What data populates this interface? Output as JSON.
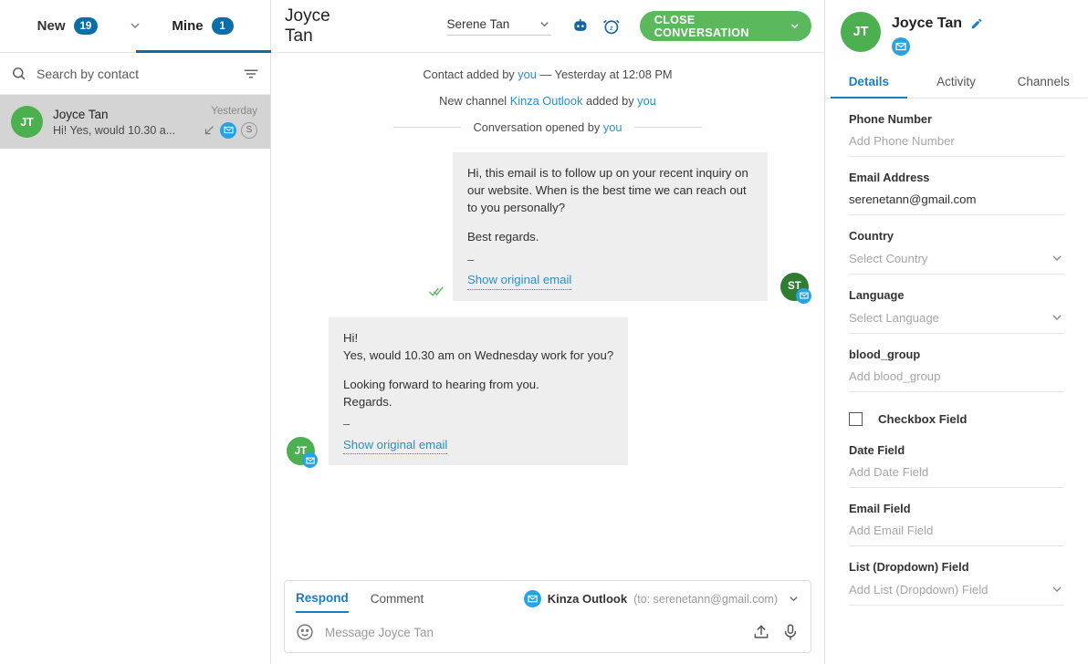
{
  "inbox": {
    "tabs": [
      {
        "label": "New",
        "count": "19",
        "active": false
      },
      {
        "label": "Mine",
        "count": "1",
        "active": true
      }
    ],
    "caret_icon": "chevron-down-icon",
    "search": {
      "placeholder": "Search by contact",
      "value": "",
      "icon": "search-icon",
      "filter_icon": "filter-icon"
    },
    "conversations": [
      {
        "initials": "JT",
        "name": "Joyce Tan",
        "preview": "Hi! Yes, would 10.30 a...",
        "time": "Yesterday",
        "direction_icon": "arrow-incoming-icon",
        "channel_icon": "email-icon",
        "status_badge": "S"
      }
    ]
  },
  "conversation": {
    "title": "Joyce Tan",
    "assignee": {
      "name": "Serene Tan",
      "caret_icon": "chevron-down-icon"
    },
    "bot_icon": "bot-icon",
    "snooze_icon": "alarm-snooze-icon",
    "close_button": {
      "label": "CLOSE CONVERSATION",
      "caret_icon": "chevron-down-icon",
      "color": "#5cb85c"
    },
    "system_events": [
      {
        "parts": [
          "Contact added by ",
          "you",
          " — Yesterday at 12:08 PM"
        ],
        "links": [
          1
        ]
      },
      {
        "parts": [
          "New channel ",
          "Kinza Outlook",
          " added by ",
          "you"
        ],
        "links": [
          1,
          3
        ]
      }
    ],
    "divider_event": {
      "prefix": "Conversation opened by ",
      "link": "you"
    },
    "messages": [
      {
        "direction": "outgoing",
        "initials": "ST",
        "avatar_color": "#2e7d32",
        "channel_icon": "email-icon",
        "read_receipt_icon": "double-check-icon",
        "body_paragraph": "Hi, this email is to follow up on your recent inquiry on our website. When is the best time we can reach out to you personally?",
        "signoff": "Best regards.",
        "dash": "–",
        "original_link": "Show original email"
      },
      {
        "direction": "incoming",
        "initials": "JT",
        "avatar_color": "#4caf50",
        "channel_icon": "email-icon",
        "line1": "Hi!",
        "line2": "Yes, would 10.30 am on Wednesday work for you?",
        "line3": "Looking forward to hearing from you.",
        "line4": "Regards.",
        "dash": "–",
        "original_link": "Show original email"
      }
    ],
    "composer": {
      "tabs": [
        {
          "label": "Respond",
          "active": true
        },
        {
          "label": "Comment",
          "active": false
        }
      ],
      "channel": {
        "name": "Kinza Outlook",
        "recipient": "(to: serenetann@gmail.com)",
        "icon": "email-icon",
        "caret_icon": "chevron-down-icon"
      },
      "emoji_icon": "emoji-icon",
      "input_placeholder": "Message Joyce Tan",
      "input_value": "",
      "attach_icon": "upload-icon",
      "mic_icon": "microphone-icon"
    }
  },
  "contact_panel": {
    "initials": "JT",
    "name": "Joyce Tan",
    "edit_icon": "pencil-icon",
    "channel_icon": "email-icon",
    "tabs": [
      {
        "label": "Details",
        "active": true
      },
      {
        "label": "Activity",
        "active": false
      },
      {
        "label": "Channels",
        "active": false
      }
    ],
    "fields": [
      {
        "type": "text",
        "label": "Phone Number",
        "value": "",
        "placeholder": "Add Phone Number"
      },
      {
        "type": "text",
        "label": "Email Address",
        "value": "serenetann@gmail.com",
        "placeholder": ""
      },
      {
        "type": "select",
        "label": "Country",
        "value": "",
        "placeholder": "Select Country"
      },
      {
        "type": "select",
        "label": "Language",
        "value": "",
        "placeholder": "Select Language"
      },
      {
        "type": "text",
        "label": "blood_group",
        "value": "",
        "placeholder": "Add blood_group"
      },
      {
        "type": "checkbox",
        "label": "Checkbox Field",
        "checked": false
      },
      {
        "type": "text",
        "label": "Date Field",
        "value": "",
        "placeholder": "Add Date Field"
      },
      {
        "type": "text",
        "label": "Email Field",
        "value": "",
        "placeholder": "Add Email Field"
      },
      {
        "type": "select",
        "label": "List (Dropdown) Field",
        "value": "",
        "placeholder": "Add List (Dropdown) Field"
      }
    ]
  },
  "colors": {
    "accent_blue": "#1a7fc1",
    "badge_blue": "#0b6ea8",
    "green": "#5cb85c",
    "link_blue": "#2b8fc9"
  }
}
